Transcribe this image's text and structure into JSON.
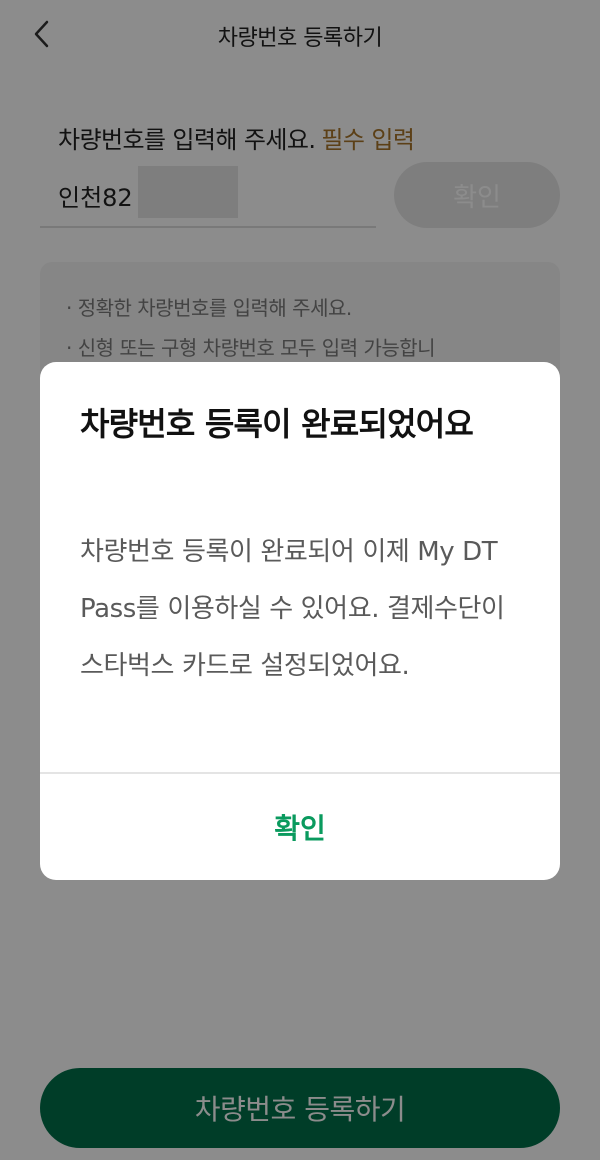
{
  "header": {
    "back_icon": "chevron-left-icon",
    "title": "차량번호 등록하기"
  },
  "form": {
    "label": "차량번호를 입력해 주세요.",
    "required_label": "필수 입력",
    "input_value": "인천82",
    "confirm_label": "확인"
  },
  "notice": {
    "lines": [
      "· 정확한 차량번호를 입력해 주세요.",
      "· 신형 또는 구형 차량번호 모두 입력 가능합니"
    ]
  },
  "footer": {
    "register_label": "차량번호 등록하기"
  },
  "dialog": {
    "title": "차량번호 등록이 완료되었어요",
    "message": "차량번호 등록이 완료되어 이제 My DT Pass를 이용하실 수 있어요. 결제수단이 스타벅스 카드로 설정되었어요.",
    "confirm_label": "확인"
  },
  "colors": {
    "brand_green": "#00704a",
    "dialog_confirm_green": "#0a9a5e",
    "required_gold": "#a8752a"
  }
}
